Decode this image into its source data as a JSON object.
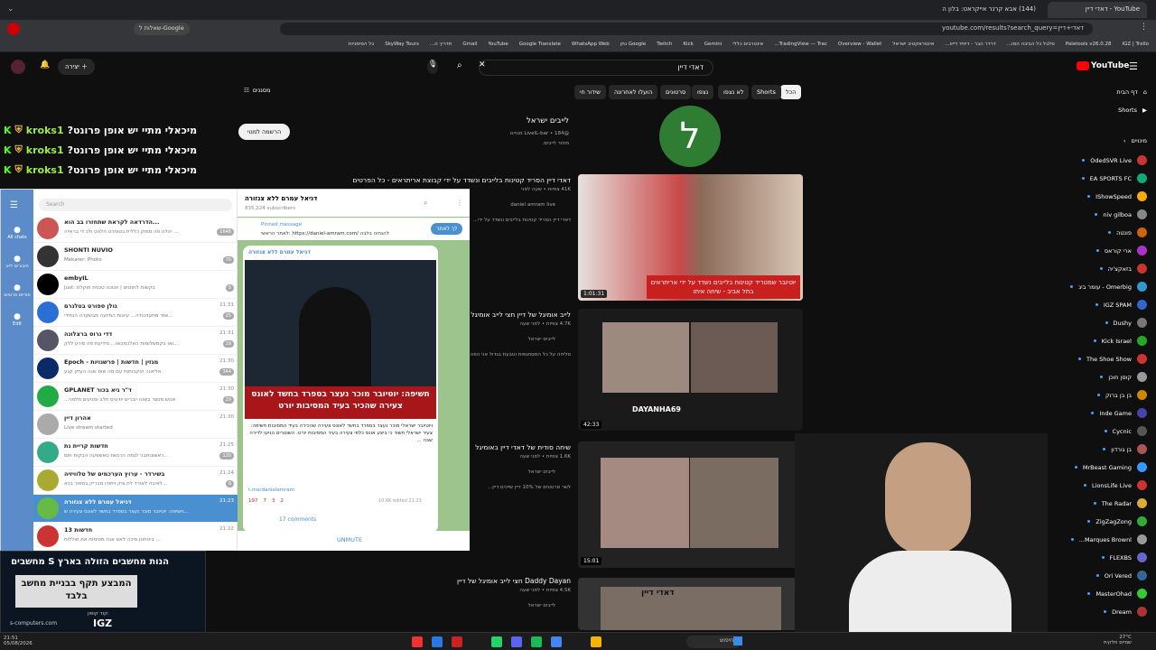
{
  "browser": {
    "tabs": [
      "YouTube - דאדי דיין",
      "(144) אבא קרנר אייקראט: בלון ה"
    ],
    "url": "youtube.com/results?search_query=דאדי+דיין",
    "search_bar_label": "שאלות ל-Google",
    "bookmarks": [
      "IGZ | Trello",
      "Paletools v26.0.28",
      "סלבל כל הביבה המו...",
      "דרדר הבר - דיוויד דייוו...",
      "אינטראקטיב ישראל",
      "Overview - Wallet",
      "TradingView — Trac...",
      "אינטרבים כללי",
      "Gemini",
      "Kick",
      "Twitch",
      "Google נתן",
      "WhatsApp Web",
      "Google Translate",
      "YouTube",
      "Gmail",
      "תדריך ה...",
      "SkyWay Tours",
      "כל הסימניות"
    ]
  },
  "youtube": {
    "logo": "YouTube",
    "search_query": "דאדי דיין",
    "create_label": "יצירה",
    "filters_label": "מסננים",
    "chips": [
      "הכל",
      "Shorts",
      "לא נצפו",
      "נצפו",
      "סרטונים",
      "הועלו לאחרונה",
      "שידור חי"
    ],
    "channel": {
      "name": "לייבים ישראל",
      "handle": "@LiveIL-bar",
      "subs": "184 מנויים",
      "desc": "מחזר לייבים.",
      "subscribe": "הרשמה למנוי",
      "avatar_letter": "ל"
    },
    "videos": [
      {
        "title": "דאדי דיין הסריד קטינות בלייבים ונשדד על ידי קבוצת אריתראים - כל הפרטים",
        "meta": "41K צפיות • שעה לפני",
        "channel": "daniel amram live",
        "desc": "דאדי דיין הסריד קטינות בלייבים ונשדד על ידי...",
        "duration": "1:01:31",
        "thumb_text": "יוטיובר שמטריד קטינות בלייבים נשדד על ידי אריתראים בתל אביב - שיחה איתו"
      },
      {
        "title": "לייב אומיגל של דיין חצי לייב אומיגל",
        "meta": "4.7K צפיות • לפני שעה",
        "channel": "לייבים ישראל",
        "desc": "סליחה על כל המסתגפות וטבעת בגדול אני הפה...",
        "duration": "42:33",
        "thumb_text": "DAYANHA69"
      },
      {
        "title": "שיחה סודית של דאדי דיין באומיגל",
        "meta": "1.6K צפיות • לפני שעה",
        "channel": "לייבים ישראל",
        "desc": "לשר סרטונים של 10% דיין שייכים דיין...",
        "duration": "15:01",
        "thumb_text": ""
      },
      {
        "title": "Daddy Dayan חצי לייב אומיגל של דיין",
        "meta": "4.5K צפיות • לפני שעה",
        "channel": "לייבים ישראל",
        "desc": "",
        "duration": "",
        "thumb_text": "דאדי דיין"
      }
    ],
    "sidebar": {
      "home": "דף הבית",
      "shorts": "Shorts",
      "subs_header": "מינויים",
      "subs": [
        "OdedSVR Live",
        "EA SPORTS FC",
        "IShowSpeed",
        "niv gilboa",
        "פונטה",
        "ארי קוראס",
        "בזאקצ'יה",
        "Omerbig - עומר ביג",
        "IGZ SPAM",
        "Dushy",
        "Kick Israel",
        "The Shoe Show",
        "קוסן חוכן",
        "בן בן ברוק",
        "Inde Game",
        "Cycnic",
        "בן גורדון",
        "MrBeast Gaming",
        "LionsLife Live",
        "The Radar",
        "ZigZagZong",
        "Marques Brownl...",
        "FLEXBS",
        "Ori Vered",
        "MasterOhad",
        "Dream"
      ]
    }
  },
  "chat": {
    "lines": [
      {
        "user": "kroks1",
        "msg": "?מיכאלי מתיי יש אופן פרונט"
      },
      {
        "user": "kroks1",
        "msg": "?מיכאלי מתיי יש אופן פרונט"
      },
      {
        "user": "kroks1",
        "msg": "?מיכאלי מתיי יש אופן פרונט"
      }
    ]
  },
  "telegram": {
    "search": "Search",
    "all_chats": "All chats",
    "channel_name": "דניאל עמרם ללא צנזורה",
    "channel_subs": "835,224 subscribers",
    "pinned_label": "Pinned message",
    "pinned_text": "לאתר הראשי: https://daniel-amram.com/ להנחיה בלבה",
    "join_btn": "לך לאתר",
    "post_author": "דניאל עמרם ללא צנזורה",
    "post_headline": "חשיפה: יוטיובר מוכר נעצר בספרד בחשד לאונס צעירה שהכיר בעיד המסיבות יורט",
    "post_body": "ויוטיובר ישראלי מוכר נעצר בספרד בחשד לאונס צעירה שהכירה בעיד המסיבות חשיפה: צעיר ישראלי חשוד כי ביצע אונס כלפי צעירה בעיר המסיבות יורט. השוטרים הגיעו לדירה שבה ...",
    "post_link": "t.me/danielamram",
    "reactions": [
      "197",
      "7",
      "3",
      "2"
    ],
    "views": "10.6K",
    "edited": "edited 21:23",
    "comments": "17 comments",
    "unmute": "UNMUTE",
    "rail": [
      "All chats",
      "חיבורים לייב",
      "סודיים פרטיים",
      "Edit"
    ],
    "chats": [
      {
        "name": "הדרדאה לקראת שתחזרו בב הוא...",
        "preview": "יהלנו פה מותק כללית בטוחרט הלהט ולכ די בראייה ...",
        "time": "",
        "badge": "1648"
      },
      {
        "name": "SHONTI NUVIO",
        "preview": "Mekarer: Photo",
        "time": "",
        "badge": "70"
      },
      {
        "name": "embyIL",
        "preview": "Just: בקשות לחוזנים | חנוכה טכנית חוקלת",
        "time": "",
        "badge": "5"
      },
      {
        "name": "גולן ספורט בטלגרם",
        "preview": "שנד מתעדכנדה... עיונות המיועה מבשקדה הנחידי...",
        "time": "21:31",
        "badge": "25"
      },
      {
        "name": "דדי גרוס ברצלונה",
        "preview": "ואו בקמשלומות האלכמבשו... מידיעת פה סירע ללק...",
        "time": "21:31",
        "badge": "19"
      },
      {
        "name": "Epoch - מגזין | חדשות | פרשנויות",
        "preview": "אליאנו: הוקבותות עם מה שוס שנה העזק קגע",
        "time": "21:30",
        "badge": "344"
      },
      {
        "name": "GPLANET ד\"ר גיא בכור",
        "preview": "...אנוש מנשר בשנה יוברים יודעים חלב ומגיעים מלפני",
        "time": "21:30",
        "badge": "29"
      },
      {
        "name": "אהרון דיין",
        "preview": "Live stream started",
        "time": "21:30",
        "badge": ""
      },
      {
        "name": "חדשות קריית גת",
        "preview": "ראשונותבני לגמה הרגשת טאשפעה הבקות ותם...",
        "time": "21:25",
        "badge": "120"
      },
      {
        "name": "בשירדר - ערוץ הערכמים של טלוויזיה",
        "preview": "לאיבה לאורד לת.ציק ויתודו מבריק בספור בכא...",
        "time": "21:24",
        "badge": "8"
      },
      {
        "name": "דניאל עמרם ללא צנזורה",
        "preview": "חשיפה: יוטיובר מוכר נעצר בספרד בחשד לאונס צעירה ש...",
        "time": "21:23",
        "badge": ""
      },
      {
        "name": "חדשות 13",
        "preview": "ביטחונן מיכה לאט אנה מסימות את חוללות ...",
        "time": "21:22",
        "badge": ""
      }
    ]
  },
  "ad": {
    "title": "הנות מחשבים הזולה בארץ",
    "brand": "S מחשבים",
    "headline": "המבצע תקף בבניית מחשב בלבד",
    "code_label": "קוד קופון:",
    "code": "IGZ",
    "url": "s-computers.com",
    "time": "21:51",
    "date": "05/08/2026"
  },
  "taskbar": {
    "search": "חיפוש",
    "time": "27°C",
    "weather": "שמיים חלקית"
  }
}
